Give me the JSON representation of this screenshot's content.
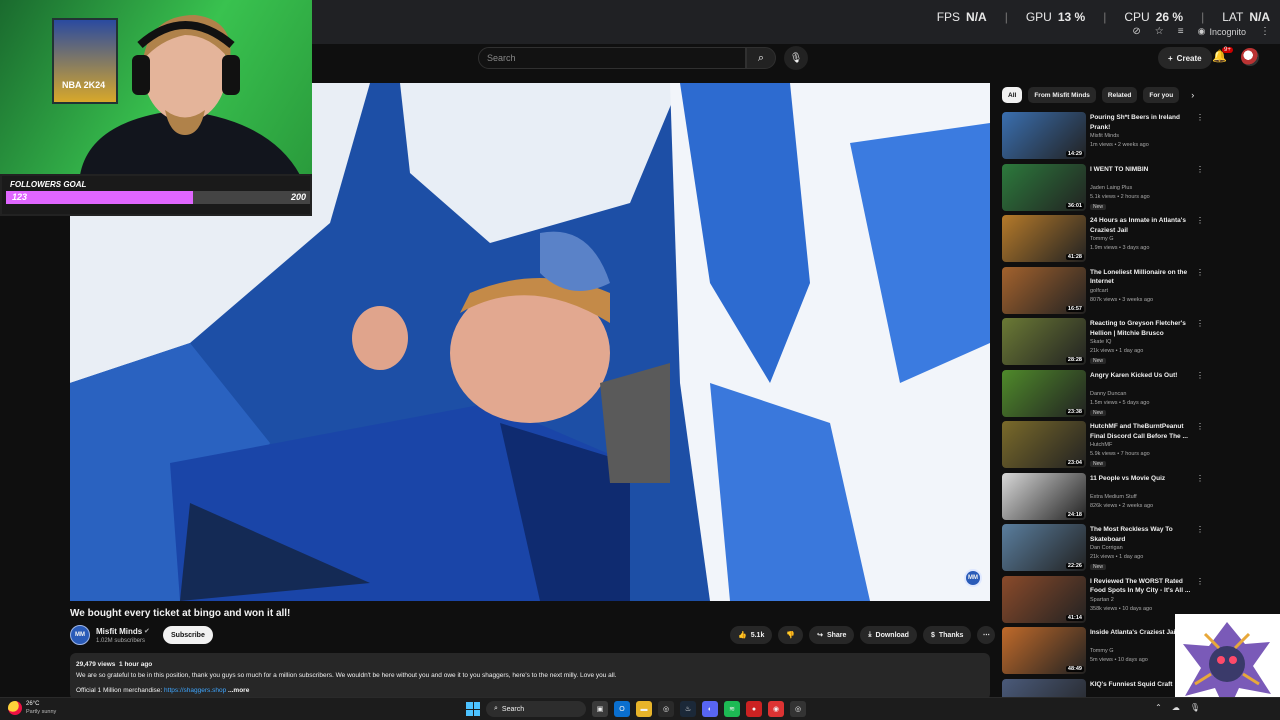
{
  "overlay": {
    "fps_label": "FPS",
    "fps_value": "N/A",
    "gpu_label": "GPU",
    "gpu_value": "13",
    "cpu_label": "CPU",
    "cpu_value": "26",
    "lat_label": "LAT",
    "lat_value": "N/A",
    "incognito": "Incognito"
  },
  "header": {
    "search_placeholder": "Search",
    "create_label": "Create",
    "notif_badge": "9+"
  },
  "webcam": {
    "poster_text": "NBA 2K24",
    "followers_goal_label": "FOLLOWERS GOAL",
    "followers_current": "123",
    "followers_target": "200",
    "followers_progress": 0.615
  },
  "video": {
    "title": "We bought every ticket at bingo and won it all!",
    "channel": "Misfit Minds",
    "subscribers": "1.02M subscribers",
    "subscribe_label": "Subscribe",
    "likes": "5.1k",
    "share_label": "Share",
    "download_label": "Download",
    "thanks_label": "Thanks",
    "watermark": "MM"
  },
  "description": {
    "views": "29,479 views",
    "time": "1 hour ago",
    "text": "We are so grateful to be in this position, thank you guys so much for a million subscribers. We wouldn't be here without you and owe it to you shaggers, here's to the next milly. Love you all.",
    "merch_label": "Official 1 Million merchandise:",
    "merch_link": "https://shaggers.shop",
    "more_label": "...more"
  },
  "chips": [
    {
      "label": "All",
      "active": true
    },
    {
      "label": "From Misfit Minds",
      "active": false
    },
    {
      "label": "Related",
      "active": false
    },
    {
      "label": "For you",
      "active": false
    }
  ],
  "recommendations": [
    {
      "title": "Pouring Sh*t Beers in Ireland Prank!",
      "channel": "Misfit Minds",
      "meta": "1m views • 2 weeks ago",
      "duration": "14:29",
      "new": false,
      "color": "#3a6fb0"
    },
    {
      "title": "I WENT TO NIMBIN",
      "channel": "Jaden Laing Plus",
      "meta": "5.1k views • 2 hours ago",
      "duration": "36:01",
      "new": true,
      "color": "#2c7a3c"
    },
    {
      "title": "24 Hours as Inmate in Atlanta's Craziest Jail",
      "channel": "Tommy G",
      "meta": "1.9m views • 3 days ago",
      "duration": "41:28",
      "new": false,
      "color": "#b57a2a"
    },
    {
      "title": "The Loneliest Millionaire on the Internet",
      "channel": "golfcart",
      "meta": "807k views • 3 weeks ago",
      "duration": "16:57",
      "new": false,
      "color": "#a3622d"
    },
    {
      "title": "Reacting to Greyson Fletcher's Hellion | Mitchie Brusco",
      "channel": "Skate IQ",
      "meta": "21k views • 1 day ago",
      "duration": "28:28",
      "new": true,
      "color": "#6b7a35"
    },
    {
      "title": "Angry Karen Kicked Us Out!",
      "channel": "Danny Duncan",
      "meta": "1.5m views • 5 days ago",
      "duration": "23:38",
      "new": true,
      "color": "#4f8a2a"
    },
    {
      "title": "HutchMF and TheBurntPeanut Final Discord Call Before The ...",
      "channel": "HutchMF",
      "meta": "5.9k views • 7 hours ago",
      "duration": "23:04",
      "new": true,
      "color": "#7a6a2a"
    },
    {
      "title": "11 People vs Movie Quiz",
      "channel": "Extra Medium Stuff",
      "meta": "826k views • 2 weeks ago",
      "duration": "24:18",
      "new": false,
      "color": "#d8d8d8"
    },
    {
      "title": "The Most Reckless Way To Skateboard",
      "channel": "Dan Corrigan",
      "meta": "21k views • 1 day ago",
      "duration": "22:26",
      "new": true,
      "color": "#5a7e9e"
    },
    {
      "title": "I Reviewed The WORST Rated Food Spots In My City - It's All ...",
      "channel": "Spartan 2",
      "meta": "358k views • 10 days ago",
      "duration": "41:14",
      "new": false,
      "color": "#8a4a2a"
    },
    {
      "title": "Inside Atlanta's Craziest Jail",
      "channel": "Tommy G",
      "meta": "5m views • 10 days ago",
      "duration": "48:49",
      "new": false,
      "color": "#c06a2a"
    },
    {
      "title": "KIQ's Funniest Squid Craft",
      "channel": "",
      "meta": "",
      "duration": "",
      "new": false,
      "color": "#4a5a7a"
    }
  ],
  "taskbar": {
    "temp": "26°C",
    "condition": "Partly sunny",
    "search_label": "Search"
  }
}
